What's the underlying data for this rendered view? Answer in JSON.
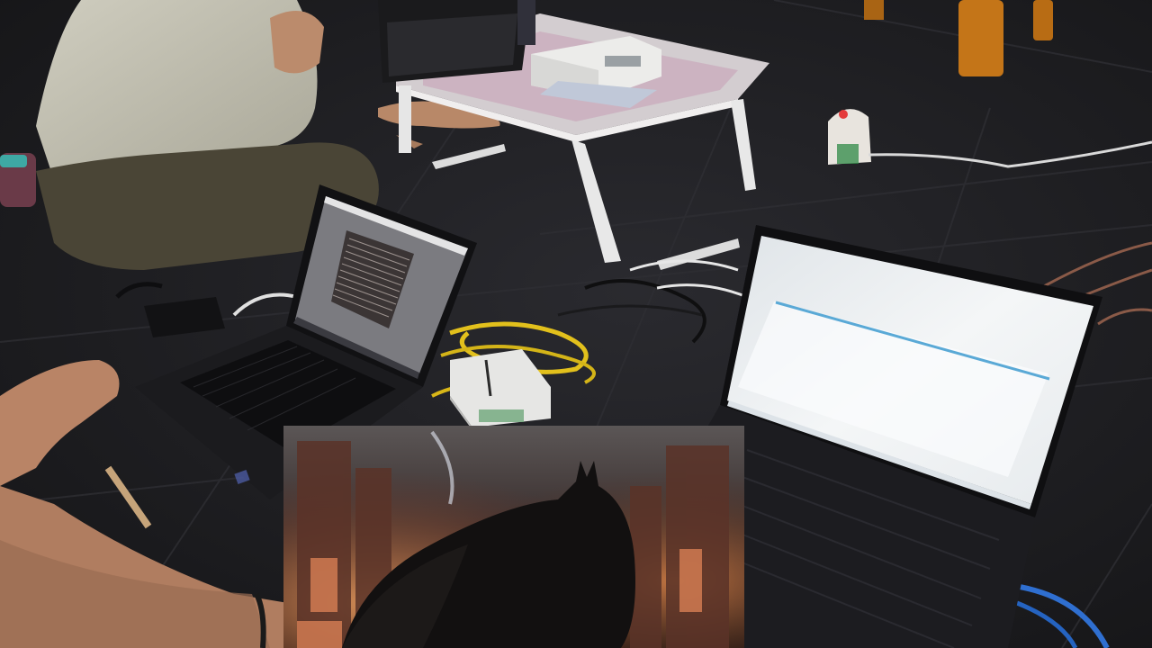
{
  "scene": {
    "kind": "photo",
    "overlay": "inset-frame-bottom-center",
    "colors": {
      "floor": "#1f1f23",
      "tile_line": "#2c2c31",
      "laptop_body": "#141416",
      "laptop_screen_left": "#7e7e84",
      "terminal_window": "#3a3434",
      "laptop_screen_right": "#eef1f3",
      "screen_progress_bar": "#5aa9d6",
      "router_white": "#e9e9e7",
      "yellow_cable": "#e4c21a",
      "blue_cable": "#2f6fd0",
      "table_top": "#d8d2d4",
      "person_shirt": "#d9d8cc",
      "person_pants": "#4a4535",
      "skin": "#c58d6d",
      "stool_orange": "#c97a1e",
      "inset_sky": "#6a6363",
      "inset_fire": "#e0703a",
      "inset_figure": "#141212"
    }
  }
}
